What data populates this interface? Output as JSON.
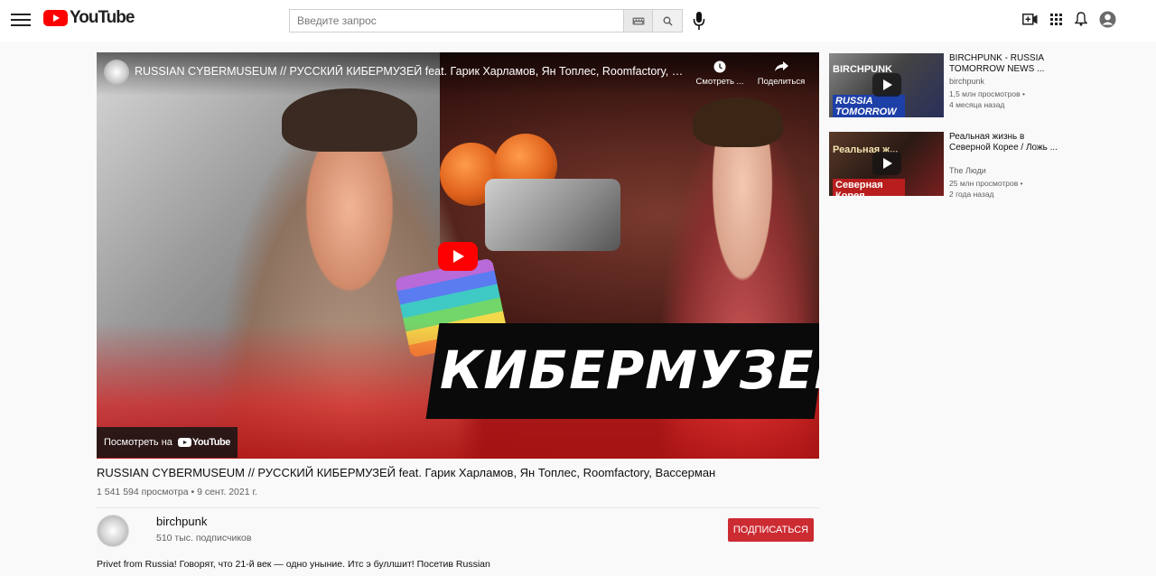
{
  "header": {
    "logo_text": "YouTube",
    "search_placeholder": "Введите запрос"
  },
  "player": {
    "overlay_title": "RUSSIAN CYBERMUSEUM // РУССКИЙ КИБЕРМУЗЕЙ feat. Гарик Харламов, Ян Топлес, Roomfactory, Вассер...",
    "watch_later_label": "Смотреть ...",
    "share_label": "Поделиться",
    "watch_on_label": "Посмотреть на",
    "watch_on_brand": "YouTube",
    "thumbnail_text": "КИБЕРМУЗЕЙ"
  },
  "video": {
    "title": "RUSSIAN CYBERMUSEUM // РУССКИЙ КИБЕРМУЗЕЙ feat. Гарик Харламов, Ян Топлес, Roomfactory, Вассерман",
    "meta": "1 541 594 просмотра • 9 сент. 2021 г.",
    "channel_name": "birchpunk",
    "subscribers": "510 тыс. подписчиков",
    "subscribe_label": "Подписаться",
    "description": "Privet from Russia! Говорят, что 21-й век — одно уныние. Итс э буллшит! Посетив Russian"
  },
  "recommendations": [
    {
      "title": "BIRCHPUNK - RUSSIA TOMORROW NEWS ...",
      "channel": "birchpunk",
      "views": "1,5 млн просмотров •",
      "age": "4 месяца назад",
      "thumb_text_top": "BIRCHPUNK",
      "thumb_text_bottom": "RUSSIA TOMORROW"
    },
    {
      "title": "Реальная жизнь в Северной Корее / Ложь ...",
      "channel": "The Люди",
      "views": "25 млн просмотров •",
      "age": "2 года назад",
      "thumb_text_top": "Реальная ж...",
      "thumb_text_bottom": "Северная Корея"
    }
  ],
  "colors": {
    "brand_red": "#ff0000",
    "subscribe_red": "#cc2b32",
    "page_bg": "#f9f9f9"
  }
}
